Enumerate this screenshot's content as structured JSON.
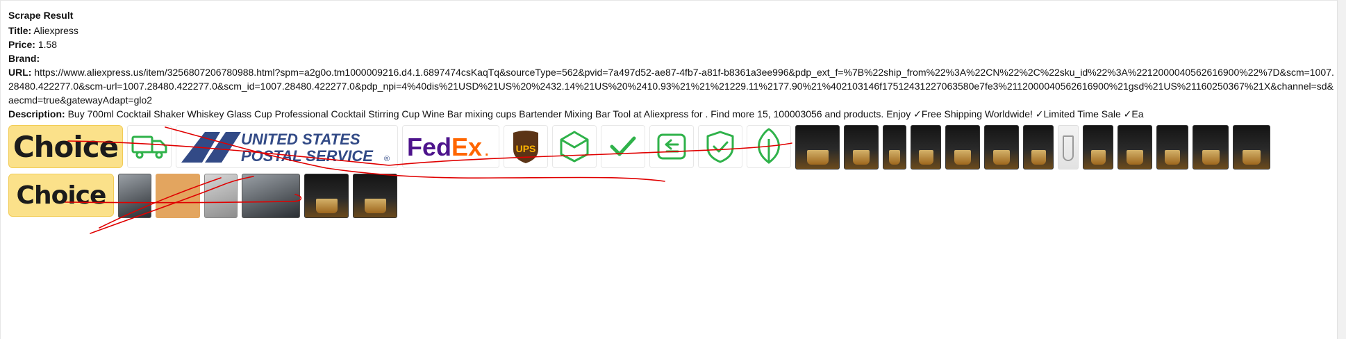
{
  "result": {
    "heading": "Scrape Result",
    "title_label": "Title:",
    "title_value": "Aliexpress",
    "price_label": "Price:",
    "price_value": "1.58",
    "brand_label": "Brand:",
    "brand_value": "",
    "url_label": "URL:",
    "url_value": "https://www.aliexpress.us/item/3256807206780988.html?spm=a2g0o.tm1000009216.d4.1.6897474csKaqTq&sourceType=562&pvid=7a497d52-ae87-4fb7-a81f-b8361a3ee996&pdp_ext_f=%7B%22ship_from%22%3A%22CN%22%2C%22sku_id%22%3A%2212000040562616900%22%7D&scm=1007.28480.422277.0&scm-url=1007.28480.422277.0&scm_id=1007.28480.422277.0&pdp_npi=4%40dis%21USD%21US%20%2432.14%21US%20%2410.93%21%21%21229.11%2177.90%21%402103146f17512431227063580e7fe3%2112000040562616900%21gsd%21US%21160250367%21X&channel=sd&aecmd=true&gatewayAdapt=glo2",
    "description_label": "Description:",
    "description_value": "Buy 700ml Cocktail Shaker Whiskey Glass Cup Professional Cocktail Stirring Cup Wine Bar mixing cups Bartender Mixing Bar Tool at Aliexpress for . Find more 15, 100003056 and products. Enjoy ✓Free Shipping Worldwide! ✓Limited Time Sale ✓Ea"
  },
  "images_row1": {
    "choice_text": "Choice",
    "usps_line1": "UNITED STATES",
    "usps_line2": "POSTAL SERVICE",
    "usps_mark": "®",
    "fedex_fed": "Fed",
    "fedex_ex": "Ex",
    "fedex_mark": ".",
    "ups_text": "UPS",
    "icons": [
      "truck-icon",
      "box-icon",
      "checkmark-icon",
      "return-icon",
      "shield-check-icon",
      "leaf-icon"
    ],
    "photo_count": 14
  },
  "images_row2": {
    "choice_text": "Choice",
    "photo_count": 6
  },
  "colors": {
    "choice_yellow": "#fbe18a",
    "icon_green": "#2fb24a",
    "usps_blue": "#324a86",
    "fedex_purple": "#4d148c",
    "fedex_orange": "#ff6600",
    "ups_brown": "#5b3416",
    "ups_gold": "#ffb500",
    "annotation_red": "#e00000"
  }
}
